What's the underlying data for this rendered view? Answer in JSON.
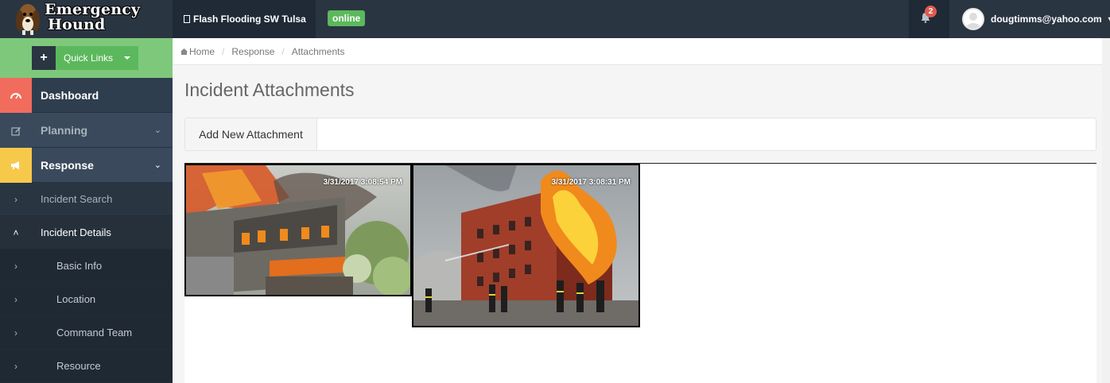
{
  "brand": {
    "line1": "Emergency",
    "line2": "Hound"
  },
  "header": {
    "incident_name": "Flash Flooding SW Tulsa",
    "status": "online",
    "notification_count": "2",
    "user_email": "dougtimms@yahoo.com"
  },
  "sidebar": {
    "quick_links": "Quick Links",
    "quick_plus": "+",
    "items": [
      {
        "label": "Dashboard",
        "icon": "dashboard-icon"
      },
      {
        "label": "Planning",
        "icon": "edit-icon"
      },
      {
        "label": "Response",
        "icon": "megaphone-icon"
      }
    ],
    "sub_items": [
      {
        "label": "Incident Search"
      },
      {
        "label": "Incident Details"
      },
      {
        "label": "Basic Info"
      },
      {
        "label": "Location"
      },
      {
        "label": "Command Team"
      },
      {
        "label": "Resource"
      }
    ]
  },
  "breadcrumb": {
    "home": "Home",
    "response": "Response",
    "current": "Attachments"
  },
  "main": {
    "title": "Incident Attachments",
    "add_button": "Add New Attachment",
    "attachments": [
      {
        "timestamp": "3/31/2017 3:08:54 PM"
      },
      {
        "timestamp": "3/31/2017 3:08:31 PM"
      }
    ]
  },
  "colors": {
    "topbar": "#2a3542",
    "quick_links_bg": "#7ec87c",
    "dashboard_accent": "#f16c5c",
    "response_accent": "#f7c94b",
    "online_badge": "#5cb85c",
    "notification_badge": "#e05a4f"
  }
}
